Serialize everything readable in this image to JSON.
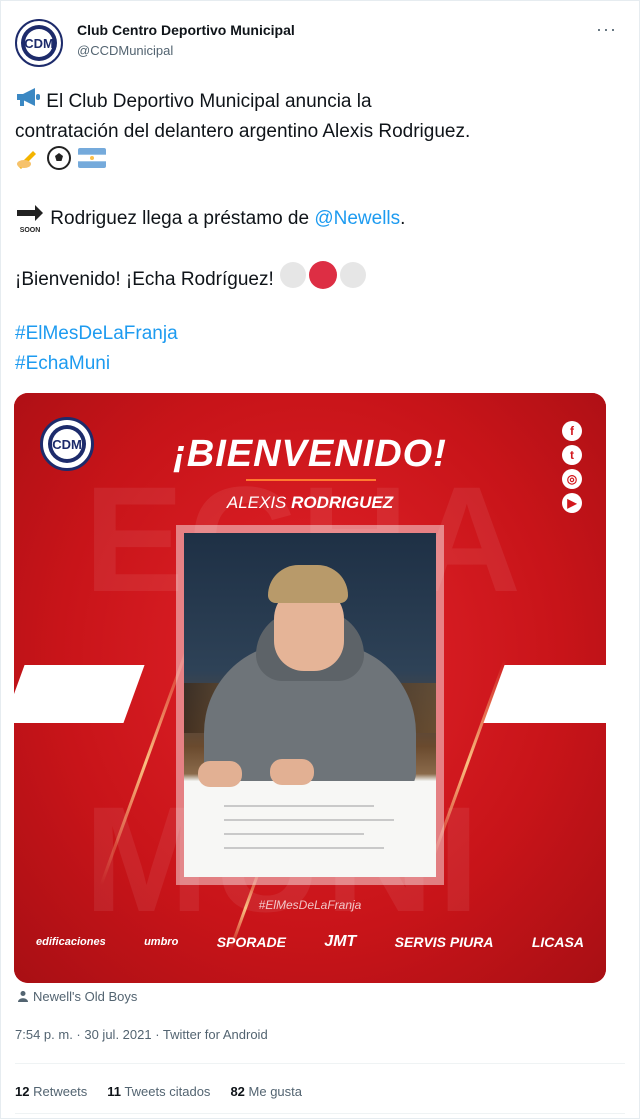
{
  "header": {
    "display_name": "Club Centro Deportivo Municipal",
    "handle": "@CCDMunicipal",
    "more_label": "···",
    "avatar_initials": "CDM"
  },
  "tweet": {
    "line1": "El Club Deportivo Municipal anuncia la",
    "line2": "contratación del delantero argentino Alexis Rodriguez.",
    "line4_prefix": "Rodriguez llega a préstamo de ",
    "mention": "@Newells",
    "line4_suffix": ".",
    "line5": "¡Bienvenido! ¡Echa Rodríguez!",
    "hashtags": [
      "#ElMesDeLaFranja",
      "#EchaMuni"
    ],
    "soon_label": "SOON"
  },
  "media": {
    "headline": "¡BIENVENIDO!",
    "player_name_first": "ALEXIS ",
    "player_name_last": "RODRIGUEZ",
    "hashtag": "#ElMesDeLaFranja",
    "bg_word_top": "ECHA",
    "bg_word_bottom": "MUNI",
    "logo_initials": "CDM",
    "social_icons": [
      "f",
      "t",
      "◎",
      "▶"
    ],
    "sponsors": [
      "edificaciones",
      "umbro",
      "SPORADE",
      "JMT",
      "SERVIS PIURA",
      "LICASA"
    ]
  },
  "footer": {
    "tagged": "Newell's Old Boys",
    "timestamp": "7:54 p. m. · 30 jul. 2021 · Twitter for Android",
    "retweets_count": "12",
    "retweets_label": "Retweets",
    "quotes_count": "11",
    "quotes_label": "Tweets citados",
    "likes_count": "82",
    "likes_label": "Me gusta"
  },
  "colors": {
    "link": "#1d9bf0",
    "club_red": "#d3171d",
    "club_navy": "#1d2b6b"
  }
}
